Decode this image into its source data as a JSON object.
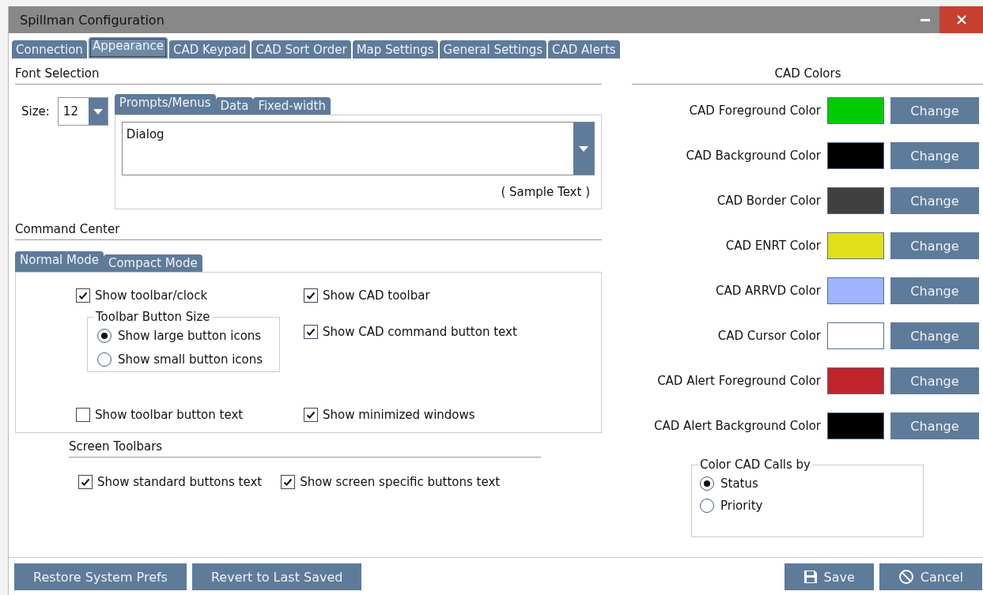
{
  "window": {
    "title": "Spillman Configuration"
  },
  "tabs": [
    {
      "label": "Connection",
      "selected": false
    },
    {
      "label": "Appearance",
      "selected": true
    },
    {
      "label": "CAD Keypad",
      "selected": false
    },
    {
      "label": "CAD Sort Order",
      "selected": false
    },
    {
      "label": "Map Settings",
      "selected": false
    },
    {
      "label": "General Settings",
      "selected": false
    },
    {
      "label": "CAD Alerts",
      "selected": false
    }
  ],
  "font_selection": {
    "title": "Font Selection",
    "size_label": "Size:",
    "size_value": "12",
    "tabs": [
      {
        "label": "Prompts/Menus",
        "selected": true
      },
      {
        "label": "Data",
        "selected": false
      },
      {
        "label": "Fixed-width",
        "selected": false
      }
    ],
    "font_value": "Dialog",
    "sample": "( Sample Text )"
  },
  "command_center": {
    "title": "Command Center",
    "tabs": [
      {
        "label": "Normal Mode",
        "selected": true
      },
      {
        "label": "Compact Mode",
        "selected": false
      }
    ],
    "toolbar_clock": {
      "label": "Show toolbar/clock",
      "checked": true
    },
    "button_size": {
      "title": "Toolbar Button Size",
      "options": [
        {
          "label": "Show large button icons",
          "selected": true
        },
        {
          "label": "Show small button icons",
          "selected": false
        }
      ]
    },
    "toolbar_text": {
      "label": "Show toolbar button text",
      "checked": false
    },
    "right_options": [
      {
        "label": "Show CAD toolbar",
        "checked": true
      },
      {
        "label": "Show CAD command button text",
        "checked": true
      },
      {
        "label": "Show minimized windows",
        "checked": true
      }
    ]
  },
  "screen_toolbars": {
    "title": "Screen Toolbars",
    "options": [
      {
        "label": "Show standard buttons text",
        "checked": true
      },
      {
        "label": "Show screen specific buttons text",
        "checked": true
      }
    ]
  },
  "cad_colors": {
    "title": "CAD Colors",
    "items": [
      {
        "label": "CAD Foreground Color",
        "color": "#00cc00",
        "button": "Change"
      },
      {
        "label": "CAD Background Color",
        "color": "#000000",
        "button": "Change"
      },
      {
        "label": "CAD Border Color",
        "color": "#404040",
        "button": "Change"
      },
      {
        "label": "CAD ENRT Color",
        "color": "#e0e018",
        "button": "Change"
      },
      {
        "label": "CAD ARRVD Color",
        "color": "#a0b4ff",
        "button": "Change"
      },
      {
        "label": "CAD Cursor Color",
        "color": "#ffffff",
        "button": "Change"
      },
      {
        "label": "CAD Alert Foreground Color",
        "color": "#c0242c",
        "button": "Change"
      },
      {
        "label": "CAD Alert Background Color",
        "color": "#000000",
        "button": "Change"
      }
    ],
    "calls_by": {
      "title": "Color CAD Calls by",
      "options": [
        {
          "label": "Status",
          "selected": true
        },
        {
          "label": "Priority",
          "selected": false
        }
      ]
    }
  },
  "footer": {
    "left_buttons": [
      {
        "label": "Restore System Prefs"
      },
      {
        "label": "Revert to Last Saved"
      }
    ],
    "right_buttons": [
      {
        "label": "Save",
        "kind": "save"
      },
      {
        "label": "Cancel",
        "kind": "cancel"
      }
    ]
  }
}
